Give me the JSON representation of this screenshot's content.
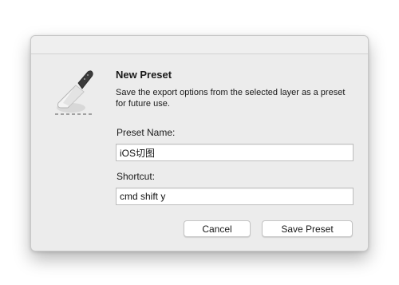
{
  "dialog": {
    "title": "New Preset",
    "description": "Save the export options from the selected layer as a preset for future use.",
    "icon": "knife-slice-icon"
  },
  "form": {
    "preset_name_label": "Preset Name:",
    "preset_name_value": "iOS切图",
    "shortcut_label": "Shortcut:",
    "shortcut_value": "cmd shift y"
  },
  "buttons": {
    "cancel_label": "Cancel",
    "save_label": "Save Preset"
  }
}
